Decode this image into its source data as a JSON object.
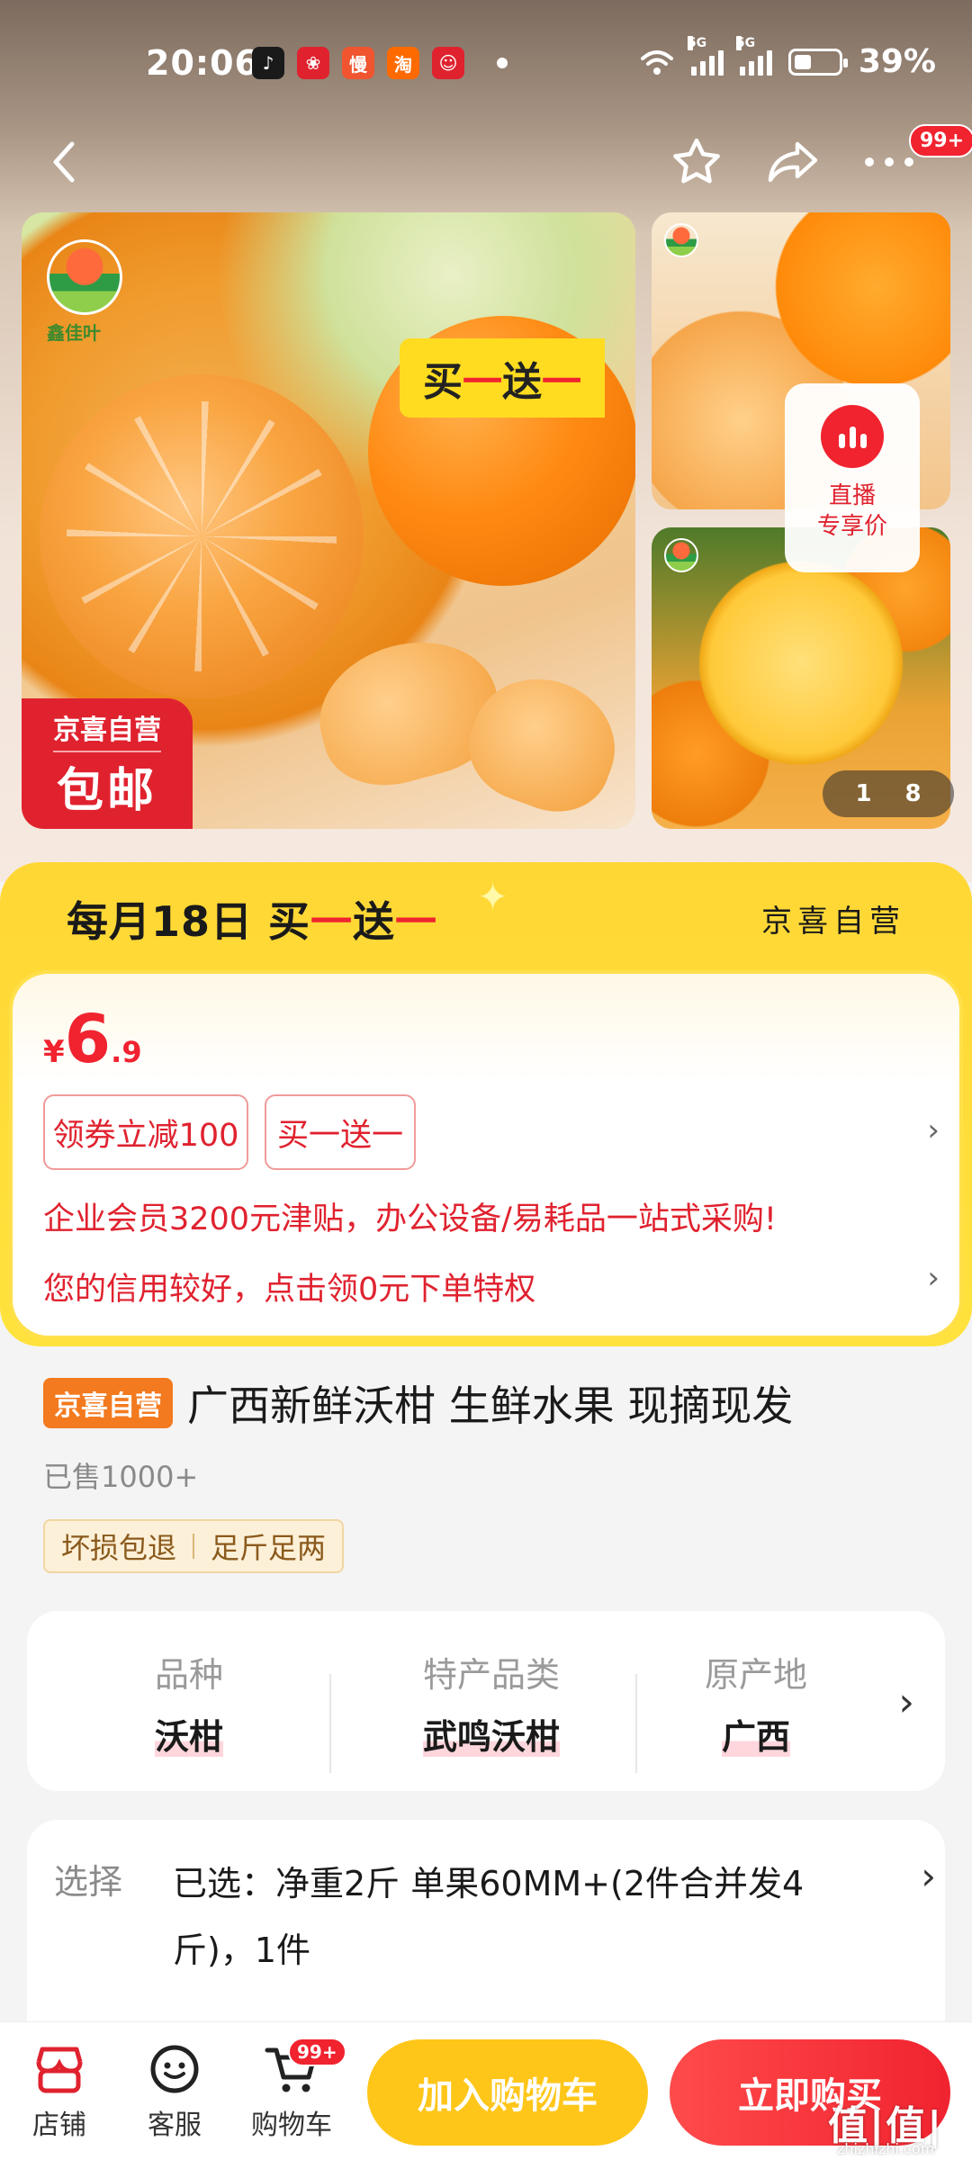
{
  "status_bar": {
    "time": "20:06",
    "apps": [
      {
        "icon": "douyin-app-icon",
        "color": "#1a1a1a",
        "glyph": "♪"
      },
      {
        "icon": "gift-app-icon",
        "color": "#e0222f",
        "glyph": "❀"
      },
      {
        "icon": "man-app-icon",
        "color": "#f0552f",
        "glyph": "慢"
      },
      {
        "icon": "taobao-app-icon",
        "color": "#ff6a00",
        "glyph": "淘"
      },
      {
        "icon": "jd-app-icon",
        "color": "#e0222f",
        "glyph": "☺"
      }
    ],
    "battery": "39%",
    "network_1": "5G",
    "network_2": "5G"
  },
  "nav": {
    "more_badge": "99+"
  },
  "gallery": {
    "main_logo_text": "鑫佳叶",
    "main_promo_left": "买",
    "main_promo_red1": "一",
    "main_promo_mid": "送",
    "main_promo_red2": "一",
    "seal_top": "京喜自营",
    "seal_bottom": "包邮",
    "live_label_1": "直播",
    "live_label_2": "专享价",
    "pager_current": "1",
    "pager_total": "8"
  },
  "promo": {
    "title_prefix": "每月18日 买",
    "title_red1": "一",
    "title_mid": "送",
    "title_red2": "一",
    "store": "京喜自营",
    "price_symbol": "¥",
    "price_int": "6",
    "price_dec": ".9",
    "coupon_tag": "领券立减100",
    "bogo_tag": "买一送一",
    "enterprise_text": "企业会员3200元津贴，办公设备/易耗品一站式采购!",
    "credit_text": "您的信用较好，点击领0元下单特权"
  },
  "product": {
    "store_tag": "京喜自营",
    "title": "广西新鲜沃柑 生鲜水果 现摘现发",
    "sold": "已售1000+",
    "guarantee_1": "坏损包退",
    "guarantee_2": "足斤足两"
  },
  "attributes": [
    {
      "key": "品种",
      "value": "沃柑"
    },
    {
      "key": "特产品类",
      "value": "武鸣沃柑"
    },
    {
      "key": "原产地",
      "value": "广西"
    }
  ],
  "selection": {
    "key": "选择",
    "value": "已选：净重2斤 单果60MM+(2件合并发4斤)，1件"
  },
  "bottom_bar": {
    "store_label": "店铺",
    "service_label": "客服",
    "cart_label": "购物车",
    "cart_badge": "99+",
    "add_to_cart": "加入购物车",
    "buy_now": "立即购买"
  },
  "watermark": {
    "text": "值|值|值",
    "sub": "zhizhizhi.com"
  }
}
